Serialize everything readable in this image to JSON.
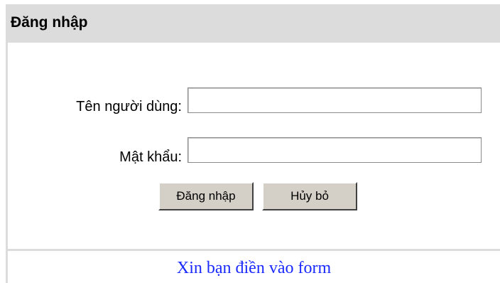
{
  "header": {
    "title": "Đăng nhập"
  },
  "form": {
    "username_label": "Tên người dùng:",
    "username_value": "",
    "password_label": "Mật khẩu:",
    "password_value": "",
    "login_button": "Đăng nhập",
    "cancel_button": "Hủy bỏ"
  },
  "footer": {
    "message": "Xin bạn điền vào form"
  },
  "colors": {
    "header_bg": "#dcdcdc",
    "message_text": "#1a2aff",
    "button_face": "#d4d0c8"
  }
}
